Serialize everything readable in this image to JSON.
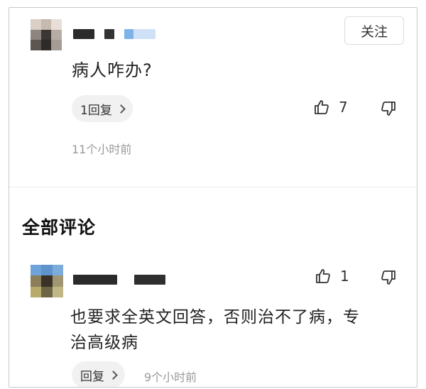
{
  "question_post": {
    "follow_label": "关注",
    "question_text": "病人咋办?",
    "reply_count_label": "1回复",
    "like_count": "7",
    "timestamp": "11个小时前",
    "icons": {
      "like": "thumbs-up-icon",
      "dislike": "thumbs-down-icon",
      "chevron": "chevron-right-icon"
    }
  },
  "comments_section": {
    "title": "全部评论",
    "comments": [
      {
        "text_line1": "也要求全英文回答，否则治不了病，专",
        "text_line2": "治高级病",
        "like_count": "1",
        "reply_label": "回复",
        "timestamp": "9个小时前"
      }
    ]
  },
  "colors": {
    "blue_badge": "#7fb2e8",
    "time_gray": "#999999"
  }
}
